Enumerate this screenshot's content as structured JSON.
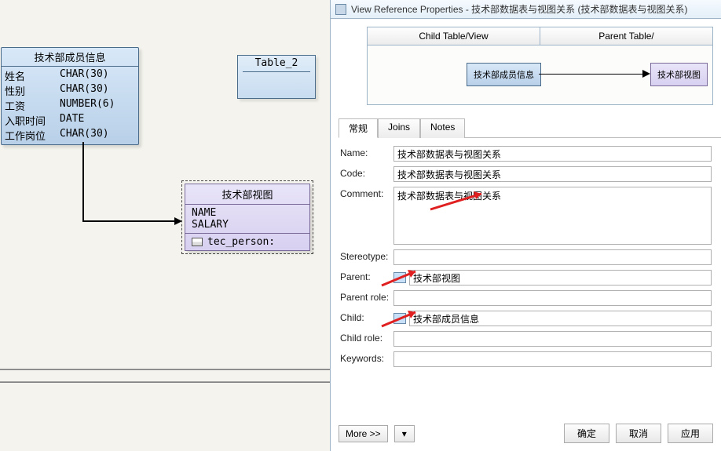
{
  "canvas": {
    "entity": {
      "title": "技术部成员信息",
      "rows": [
        {
          "name": "姓名",
          "type": "CHAR(30)"
        },
        {
          "name": "性别",
          "type": "CHAR(30)"
        },
        {
          "name": "工资",
          "type": "NUMBER(6)"
        },
        {
          "name": "入职时间",
          "type": "DATE"
        },
        {
          "name": "工作岗位",
          "type": "CHAR(30)"
        }
      ]
    },
    "table2": {
      "label": "Table_2"
    },
    "view": {
      "title": "技术部视图",
      "cols": [
        "NAME",
        "SALARY"
      ],
      "source": "tec_person:"
    }
  },
  "window": {
    "title": "View Reference Properties - 技术部数据表与视图关系 (技术部数据表与视图关系)",
    "headers": {
      "child": "Child Table/View",
      "parent": "Parent Table/"
    },
    "miniChild": "技术部成员信息",
    "miniParent": "技术部视图",
    "tabs": {
      "general": "常规",
      "joins": "Joins",
      "notes": "Notes"
    },
    "form": {
      "nameLabel": "Name:",
      "codeLabel": "Code:",
      "commentLabel": "Comment:",
      "stereotypeLabel": "Stereotype:",
      "parentLabel": "Parent:",
      "parentRoleLabel": "Parent role:",
      "childLabel": "Child:",
      "childRoleLabel": "Child role:",
      "keywordsLabel": "Keywords:",
      "name": "技术部数据表与视图关系",
      "code": "技术部数据表与视图关系",
      "comment": "技术部数据表与视图关系",
      "stereotype": "",
      "parent": "技术部视图",
      "parentRole": "",
      "child": "技术部成员信息",
      "childRole": "",
      "keywords": ""
    },
    "buttons": {
      "more": "More >>",
      "ok": "确定",
      "cancel": "取消",
      "apply": "应用"
    }
  }
}
